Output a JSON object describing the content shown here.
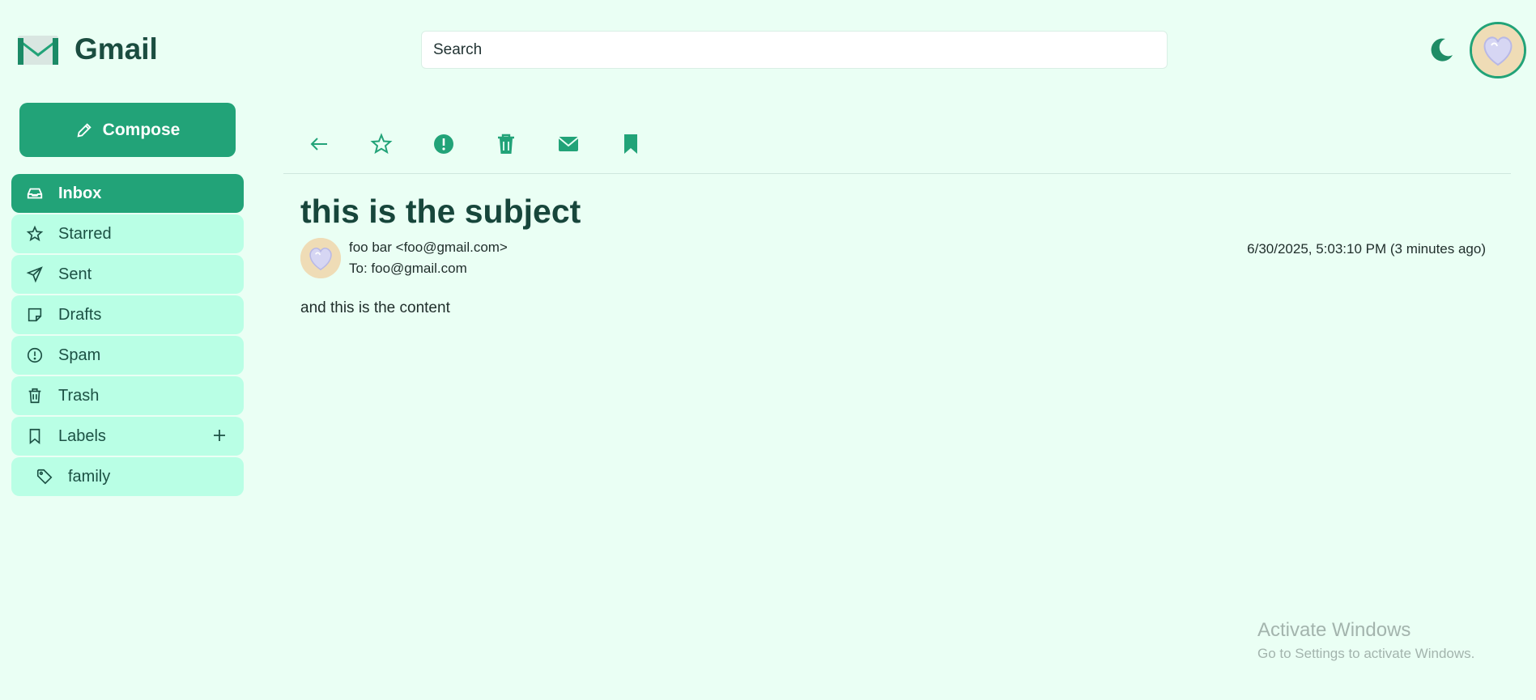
{
  "app": {
    "name": "Gmail"
  },
  "search": {
    "placeholder": "Search"
  },
  "sidebar": {
    "compose_label": "Compose",
    "items": [
      {
        "label": "Inbox",
        "icon": "inbox-icon",
        "active": true
      },
      {
        "label": "Starred",
        "icon": "star-icon"
      },
      {
        "label": "Sent",
        "icon": "send-icon"
      },
      {
        "label": "Drafts",
        "icon": "draft-icon"
      },
      {
        "label": "Spam",
        "icon": "spam-icon"
      },
      {
        "label": "Trash",
        "icon": "trash-icon"
      },
      {
        "label": "Labels",
        "icon": "bookmark-icon",
        "action_icon": "plus-icon"
      },
      {
        "label": "family",
        "icon": "tag-icon"
      }
    ]
  },
  "toolbar": {
    "actions": [
      "back-arrow-icon",
      "star-icon",
      "spam-icon",
      "trash-icon",
      "mail-icon",
      "bookmark-icon"
    ]
  },
  "message": {
    "subject": "this is the subject",
    "from": "foo bar <foo@gmail.com>",
    "to": "To: foo@gmail.com",
    "date": "6/30/2025, 5:03:10 PM (3 minutes ago)",
    "body": "and this is the content"
  },
  "watermark": {
    "title": "Activate Windows",
    "subtitle": "Go to Settings to activate Windows."
  },
  "colors": {
    "background": "#eafff4",
    "accent": "#22a378",
    "nav_bg": "#b9ffe5",
    "text_dark": "#17463b"
  }
}
